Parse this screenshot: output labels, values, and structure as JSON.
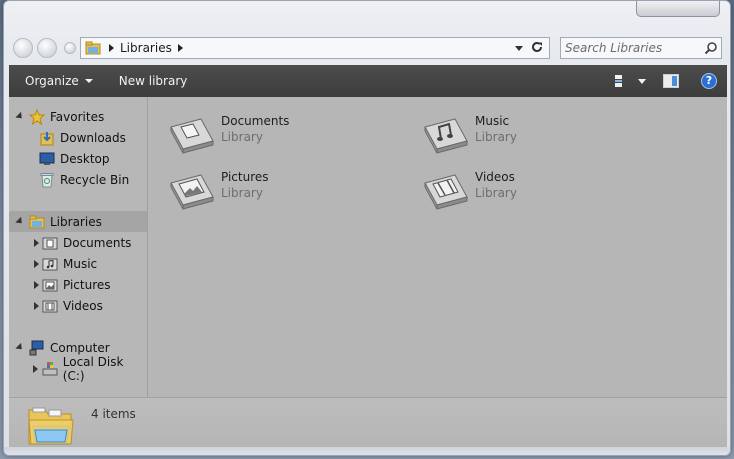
{
  "address": {
    "crumbs": [
      "Libraries"
    ]
  },
  "search": {
    "placeholder": "Search Libraries"
  },
  "toolbar": {
    "organize_label": "Organize",
    "new_library_label": "New library"
  },
  "nav": {
    "favorites": {
      "label": "Favorites",
      "items": [
        {
          "label": "Downloads",
          "icon": "downloads-icon"
        },
        {
          "label": "Desktop",
          "icon": "desktop-icon"
        },
        {
          "label": "Recycle Bin",
          "icon": "recycle-bin-icon"
        }
      ]
    },
    "libraries": {
      "label": "Libraries",
      "items": [
        {
          "label": "Documents",
          "icon": "documents-library-icon"
        },
        {
          "label": "Music",
          "icon": "music-library-icon"
        },
        {
          "label": "Pictures",
          "icon": "pictures-library-icon"
        },
        {
          "label": "Videos",
          "icon": "videos-library-icon"
        }
      ]
    },
    "computer": {
      "label": "Computer",
      "items": [
        {
          "label": "Local Disk (C:)",
          "icon": "local-disk-icon"
        }
      ]
    }
  },
  "libraries": [
    {
      "name": "Documents",
      "type": "Library",
      "icon": "documents-library-icon"
    },
    {
      "name": "Music",
      "type": "Library",
      "icon": "music-library-icon"
    },
    {
      "name": "Pictures",
      "type": "Library",
      "icon": "pictures-library-icon"
    },
    {
      "name": "Videos",
      "type": "Library",
      "icon": "videos-library-icon"
    }
  ],
  "details": {
    "count_text": "4 items"
  }
}
